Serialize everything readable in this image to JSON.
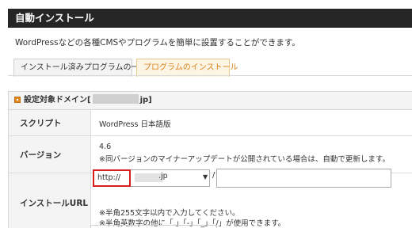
{
  "header": {
    "title": "自動インストール"
  },
  "description": "WordPressなどの各種CMSやプログラムを簡単に設置することができます。",
  "tabs": [
    {
      "label": "インストール済みプログラムの一覧",
      "active": false
    },
    {
      "label": "プログラムのインストール",
      "active": true
    }
  ],
  "panel": {
    "title_prefix": "設定対象ドメイン[",
    "title_suffix": "jp]"
  },
  "rows": {
    "script": {
      "label": "スクリプト",
      "value": "WordPress 日本語版"
    },
    "version": {
      "label": "バージョン",
      "value": "4.6",
      "note": "※同バージョンのマイナーアップデートが公開されている場合は、自動で更新します。"
    },
    "url": {
      "label": "インストールURL",
      "protocol": "http://",
      "domain_suffix": ".jp",
      "slash": "/",
      "path_value": "",
      "note1": "※半角255文字以内で入力してください。",
      "note2": "※半角英数字の他に「.」「-」「_」「/」が使用できます。"
    }
  },
  "colors": {
    "header_bg": "#262626",
    "active_tab_text": "#d9821b",
    "highlight_border": "#d91e1e",
    "section_icon": "#e08a1e"
  },
  "icons": {
    "section": "orange-square-icon",
    "select_arrow": "chevron-down-icon"
  }
}
